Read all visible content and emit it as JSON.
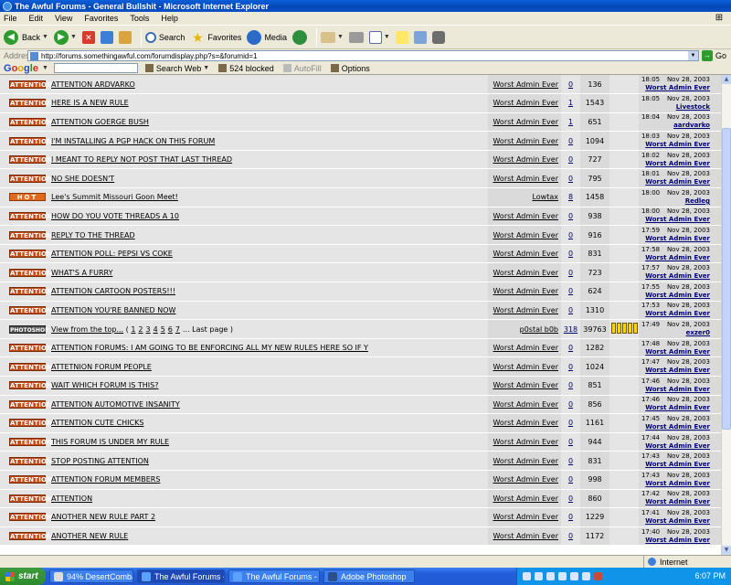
{
  "window": {
    "title": "The Awful Forums - General Bullshit - Microsoft Internet Explorer"
  },
  "menubar": {
    "items": [
      "File",
      "Edit",
      "View",
      "Favorites",
      "Tools",
      "Help"
    ]
  },
  "toolbar": {
    "back_label": "Back",
    "search_label": "Search",
    "favorites_label": "Favorites",
    "media_label": "Media"
  },
  "address": {
    "label": "Address",
    "url": "http://forums.somethingawful.com/forumdisplay.php?s=&forumid=1",
    "go_label": "Go"
  },
  "googlebar": {
    "logo": [
      "G",
      "o",
      "o",
      "g",
      "l",
      "e"
    ],
    "search_web_label": "Search Web",
    "blocked_label": "524 blocked",
    "autofill_label": "AutoFill",
    "options_label": "Options"
  },
  "threads": [
    {
      "tag": "ATTENTION",
      "tag_type": "attention",
      "title": "ATTENTION ARDVARKO",
      "author": "Worst Admin Ever",
      "replies": "0",
      "views": "136",
      "time": "18:05",
      "date": "Nov 28, 2003",
      "last_poster": "Worst Admin Ever"
    },
    {
      "tag": "ATTENTION",
      "tag_type": "attention",
      "title": "HERE IS A NEW RULE",
      "author": "Worst Admin Ever",
      "replies": "1",
      "views": "1543",
      "time": "18:05",
      "date": "Nov 28, 2003",
      "last_poster": "Livestock"
    },
    {
      "tag": "ATTENTION",
      "tag_type": "attention",
      "title": "ATTENTION GOERGE BUSH",
      "author": "Worst Admin Ever",
      "replies": "1",
      "views": "651",
      "time": "18:04",
      "date": "Nov 28, 2003",
      "last_poster": "aardvarko"
    },
    {
      "tag": "ATTENTION",
      "tag_type": "attention",
      "title": "I'M INSTALLING A PGP HACK ON THIS FORUM",
      "author": "Worst Admin Ever",
      "replies": "0",
      "views": "1094",
      "time": "18:03",
      "date": "Nov 28, 2003",
      "last_poster": "Worst Admin Ever"
    },
    {
      "tag": "ATTENTION",
      "tag_type": "attention",
      "title": "I MEANT TO REPLY NOT POST THAT LAST THREAD",
      "author": "Worst Admin Ever",
      "replies": "0",
      "views": "727",
      "time": "18:02",
      "date": "Nov 28, 2003",
      "last_poster": "Worst Admin Ever"
    },
    {
      "tag": "ATTENTION",
      "tag_type": "attention",
      "title": "NO SHE DOESN'T",
      "author": "Worst Admin Ever",
      "replies": "0",
      "views": "795",
      "time": "18:01",
      "date": "Nov 28, 2003",
      "last_poster": "Worst Admin Ever"
    },
    {
      "tag": "HOT",
      "tag_type": "hot",
      "title": "Lee's Summit Missouri Goon Meet!",
      "author": "Lowtax",
      "replies": "8",
      "views": "1458",
      "time": "18:00",
      "date": "Nov 28, 2003",
      "last_poster": "Redleg"
    },
    {
      "tag": "ATTENTION",
      "tag_type": "attention",
      "title": "HOW DO YOU VOTE THREADS A 10",
      "author": "Worst Admin Ever",
      "replies": "0",
      "views": "938",
      "time": "18:00",
      "date": "Nov 28, 2003",
      "last_poster": "Worst Admin Ever"
    },
    {
      "tag": "ATTENTION",
      "tag_type": "attention",
      "title": "REPLY TO THE THREAD",
      "author": "Worst Admin Ever",
      "replies": "0",
      "views": "916",
      "time": "17:59",
      "date": "Nov 28, 2003",
      "last_poster": "Worst Admin Ever"
    },
    {
      "tag": "ATTENTION",
      "tag_type": "attention",
      "title": "ATTENTION POLL: PEPSI VS COKE",
      "author": "Worst Admin Ever",
      "replies": "0",
      "views": "831",
      "time": "17:58",
      "date": "Nov 28, 2003",
      "last_poster": "Worst Admin Ever"
    },
    {
      "tag": "ATTENTION",
      "tag_type": "attention",
      "title": "WHAT'S A FURRY",
      "author": "Worst Admin Ever",
      "replies": "0",
      "views": "723",
      "time": "17:57",
      "date": "Nov 28, 2003",
      "last_poster": "Worst Admin Ever"
    },
    {
      "tag": "ATTENTION",
      "tag_type": "attention",
      "title": "ATTENTION CARTOON POSTERS!!!",
      "author": "Worst Admin Ever",
      "replies": "0",
      "views": "624",
      "time": "17:55",
      "date": "Nov 28, 2003",
      "last_poster": "Worst Admin Ever"
    },
    {
      "tag": "ATTENTION",
      "tag_type": "attention",
      "title": "ATTENTION YOU'RE BANNED NOW",
      "author": "Worst Admin Ever",
      "replies": "0",
      "views": "1310",
      "time": "17:53",
      "date": "Nov 28, 2003",
      "last_poster": "Worst Admin Ever"
    },
    {
      "tag": "PHOTOSHOP",
      "tag_type": "photoshop",
      "title": "View from the top...",
      "pages": [
        "1",
        "2",
        "3",
        "4",
        "5",
        "6",
        "7"
      ],
      "pages_prefix": "(",
      "pages_suffix": "... Last page )",
      "author": "p0stal b0b",
      "replies": "318",
      "views": "39763",
      "rating": 5,
      "time": "17:49",
      "date": "Nov 28, 2003",
      "last_poster": "exzer0"
    },
    {
      "tag": "ATTENTION",
      "tag_type": "attention",
      "title": "ATTENTION FORUMS: I AM GOING TO BE ENFORCING ALL MY NEW RULES HERE SO IF Y",
      "author": "Worst Admin Ever",
      "replies": "0",
      "views": "1282",
      "time": "17:48",
      "date": "Nov 28, 2003",
      "last_poster": "Worst Admin Ever"
    },
    {
      "tag": "ATTENTION",
      "tag_type": "attention",
      "title": "ATTETNION FORUM PEOPLE",
      "author": "Worst Admin Ever",
      "replies": "0",
      "views": "1024",
      "time": "17:47",
      "date": "Nov 28, 2003",
      "last_poster": "Worst Admin Ever"
    },
    {
      "tag": "ATTENTION",
      "tag_type": "attention",
      "title": "WAIT WHICH FORUM IS THIS?",
      "author": "Worst Admin Ever",
      "replies": "0",
      "views": "851",
      "time": "17:46",
      "date": "Nov 28, 2003",
      "last_poster": "Worst Admin Ever"
    },
    {
      "tag": "ATTENTION",
      "tag_type": "attention",
      "title": "ATTENTION AUTOMOTIVE INSANITY",
      "author": "Worst Admin Ever",
      "replies": "0",
      "views": "856",
      "time": "17:46",
      "date": "Nov 28, 2003",
      "last_poster": "Worst Admin Ever"
    },
    {
      "tag": "ATTENTION",
      "tag_type": "attention",
      "title": "ATTENTION CUTE CHICKS",
      "author": "Worst Admin Ever",
      "replies": "0",
      "views": "1161",
      "time": "17:45",
      "date": "Nov 28, 2003",
      "last_poster": "Worst Admin Ever"
    },
    {
      "tag": "ATTENTION",
      "tag_type": "attention",
      "title": "THIS FORUM IS UNDER MY RULE",
      "author": "Worst Admin Ever",
      "replies": "0",
      "views": "944",
      "time": "17:44",
      "date": "Nov 28, 2003",
      "last_poster": "Worst Admin Ever"
    },
    {
      "tag": "ATTENTION",
      "tag_type": "attention",
      "title": "STOP POSTING ATTENTION",
      "author": "Worst Admin Ever",
      "replies": "0",
      "views": "831",
      "time": "17:43",
      "date": "Nov 28, 2003",
      "last_poster": "Worst Admin Ever"
    },
    {
      "tag": "ATTENTION",
      "tag_type": "attention",
      "title": "ATTENTION FORUM MEMBERS",
      "author": "Worst Admin Ever",
      "replies": "0",
      "views": "998",
      "time": "17:43",
      "date": "Nov 28, 2003",
      "last_poster": "Worst Admin Ever"
    },
    {
      "tag": "ATTENTION",
      "tag_type": "attention",
      "title": "ATTENTION",
      "author": "Worst Admin Ever",
      "replies": "0",
      "views": "860",
      "time": "17:42",
      "date": "Nov 28, 2003",
      "last_poster": "Worst Admin Ever"
    },
    {
      "tag": "ATTENTION",
      "tag_type": "attention",
      "title": "ANOTHER NEW RULE PART 2",
      "author": "Worst Admin Ever",
      "replies": "0",
      "views": "1229",
      "time": "17:41",
      "date": "Nov 28, 2003",
      "last_poster": "Worst Admin Ever"
    },
    {
      "tag": "ATTENTION",
      "tag_type": "attention",
      "title": "ANOTHER NEW RULE",
      "author": "Worst Admin Ever",
      "replies": "0",
      "views": "1172",
      "time": "17:40",
      "date": "Nov 28, 2003",
      "last_poster": "Worst Admin Ever"
    }
  ],
  "statusbar": {
    "zone_label": "Internet"
  },
  "taskbar": {
    "start_label": "start",
    "tasks": [
      "94% DesertCombat...",
      "The Awful Forums - ...",
      "The Awful Forums - f...",
      "Adobe Photoshop"
    ],
    "clock": "6:07 PM"
  }
}
